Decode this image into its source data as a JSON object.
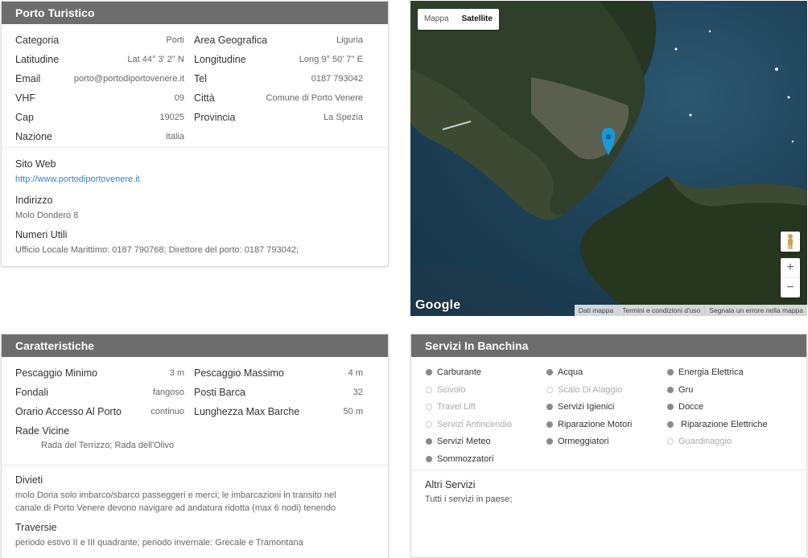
{
  "porto": {
    "title": "Porto Turistico",
    "left": [
      {
        "label": "Categoria",
        "value": "Porti"
      },
      {
        "label": "Latitudine",
        "value": "Lat 44° 3' 2'' N"
      },
      {
        "label": "Email",
        "value": "porto@portodiportovenere.it"
      },
      {
        "label": "VHF",
        "value": "09"
      },
      {
        "label": "Cap",
        "value": "19025"
      },
      {
        "label": "Nazione",
        "value": "Italia"
      }
    ],
    "right": [
      {
        "label": "Area Geografica",
        "value": "Liguria"
      },
      {
        "label": "Longitudine",
        "value": "Long 9° 50' 7'' E"
      },
      {
        "label": "Tel",
        "value": "0187 793042"
      },
      {
        "label": "Città",
        "value": "Comune di Porto Venere"
      },
      {
        "label": "Provincia",
        "value": "La Spezia"
      }
    ],
    "sito_label": "Sito Web",
    "sito_value": "http://www.portodiportovenere.it",
    "indirizzo_label": "Indirizzo",
    "indirizzo_value": "Molo Dondero 8",
    "numeri_label": "Numeri Utili",
    "numeri_value": "Ufficio Locale Marittimo: 0187 790768; Direttore del porto: 0187 793042;"
  },
  "map": {
    "type_map": "Mappa",
    "type_satellite": "Satellite",
    "zoom_in": "+",
    "zoom_out": "−",
    "logo": "Google",
    "footer": [
      "Dati mappa",
      "Termini e condizioni d'uso",
      "Segnala un errore nella mappa"
    ],
    "colors": {
      "water": "#1e4258",
      "land": "#2f3f2a",
      "marker": "#1a9ad6"
    }
  },
  "caratteristiche": {
    "title": "Caratteristiche",
    "left": [
      {
        "label": "Pescaggio Minimo",
        "value": "3 m"
      },
      {
        "label": "Fondali",
        "value": "fangoso"
      },
      {
        "label": "Orario Accesso Al Porto",
        "value": "continuo"
      }
    ],
    "right": [
      {
        "label": "Pescaggio Massimo",
        "value": "4 m"
      },
      {
        "label": "Posti Barca",
        "value": "32"
      },
      {
        "label": "Lunghezza Max Barche",
        "value": "50 m"
      }
    ],
    "rade_label": "Rade Vicine",
    "rade_value": "Rada del Terrizzo; Rada dell'Olivo",
    "divieti_label": "Divieti",
    "divieti_line1": "molo Doria solo imbarco/sbarco passeggeri e merci; le imbarcazioni in transito nel",
    "divieti_line2": "canale di Porto Venere devono navigare ad andatura ridotta (max 6 nodi) tenendo",
    "traversie_label": "Traversie",
    "traversie_value": "periodo estivo II e III quadrante; periodo invernale: Grecale e Tramontana"
  },
  "servizi": {
    "title": "Servizi In Banchina",
    "items": [
      {
        "label": "Carburante",
        "active": true
      },
      {
        "label": "Acqua",
        "active": true
      },
      {
        "label": "Energia Elettrica",
        "active": true
      },
      {
        "label": "Scivolo",
        "active": false
      },
      {
        "label": "Scalo Di Alaggio",
        "active": false
      },
      {
        "label": "Gru",
        "active": true
      },
      {
        "label": "Travel Lift",
        "active": false
      },
      {
        "label": "Servizi Igienici",
        "active": true
      },
      {
        "label": "Docce",
        "active": true
      },
      {
        "label": "Servizi Antincendio",
        "active": false
      },
      {
        "label": "Riparazione Motori",
        "active": true
      },
      {
        "label": " Riparazione Elettriche",
        "active": true
      },
      {
        "label": "Servizi Meteo",
        "active": true
      },
      {
        "label": "Ormeggiatori",
        "active": true
      },
      {
        "label": "Guardinaggio",
        "active": false
      },
      {
        "label": "Sommozzatori",
        "active": true
      }
    ],
    "altri_label": "Altri Servizi",
    "altri_value": "Tutti i servizi in paese;"
  }
}
